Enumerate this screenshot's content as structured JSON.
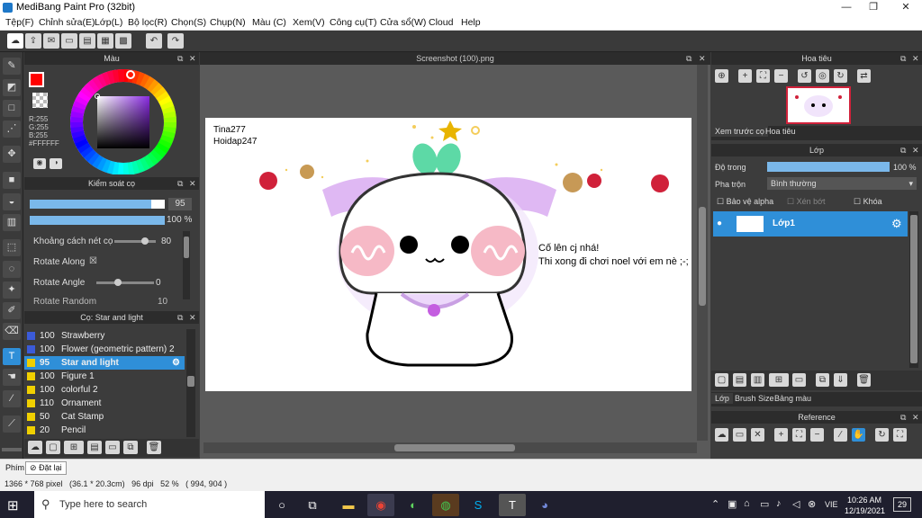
{
  "window": {
    "title": "MediBang Paint Pro (32bit)",
    "minimize_glyph": "—",
    "maximize_glyph": "❐",
    "close_glyph": "✕"
  },
  "menu": [
    "Tệp(F)",
    "Chỉnh sửa(E)",
    "Lớp(L)",
    "Bộ lọc(R)",
    "Chọn(S)",
    "Chụp(N)",
    "Màu (C)",
    "Xem(V)",
    "Công cụ(T)",
    "Cửa sổ(W)",
    "Cloud",
    "Help"
  ],
  "color_panel": {
    "title": "Màu",
    "r_label": "R:255",
    "g_label": "G:255",
    "b_label": "B:255",
    "hex": "#FFFFFF",
    "primary_color": "#ff0000",
    "secondary_color": "#ffffff"
  },
  "brush_control": {
    "title": "Kiểm soát cọ",
    "size_value": "95",
    "size_fraction": 0.9,
    "opacity_value": "100 %",
    "opacity_fraction": 1.0,
    "spacing_label": "Khoảng cách nét cọ",
    "spacing_value": "80",
    "rotate_along_label": "Rotate Along",
    "rotate_along_checked": "☒",
    "rotate_angle_label": "Rotate Angle",
    "rotate_angle_value": "0",
    "cut_label": "Rotate Random",
    "cut_value": "10"
  },
  "brush_list": {
    "title": "Cọ: Star and light",
    "items": [
      {
        "size": "100",
        "name": "Strawberry",
        "color": "#3b5bd9"
      },
      {
        "size": "100",
        "name": "Flower (geometric pattern) 2",
        "color": "#3b5bd9"
      },
      {
        "size": "95",
        "name": "Star and light",
        "color": "#f0d000",
        "selected": true
      },
      {
        "size": "100",
        "name": "Figure 1",
        "color": "#f0d000"
      },
      {
        "size": "100",
        "name": "colorful 2",
        "color": "#f0d000"
      },
      {
        "size": "110",
        "name": "Ornament",
        "color": "#f0d000"
      },
      {
        "size": "50",
        "name": "Cat Stamp",
        "color": "#f0d000"
      },
      {
        "size": "20",
        "name": "Pencil",
        "color": "#f0d000"
      }
    ]
  },
  "canvas": {
    "tab_title": "Screenshot (100).png",
    "text_top_left_1": "Tina277",
    "text_top_left_2": "Hoidap247",
    "speech_1": "Cố lên cj nhá!",
    "speech_2": "Thi xong đi chơi noel với em nè ;-;"
  },
  "navigator": {
    "title": "Hoa tiêu",
    "tab_preview": "Xem trước cọ",
    "tab_nav": "Hoa tiêu"
  },
  "layer_panel": {
    "title": "Lớp",
    "opacity_label": "Độ trong",
    "opacity_value": "100 %",
    "opacity_fraction": 1.0,
    "blend_label": "Pha trộn",
    "blend_value": "Bình thường",
    "protect_alpha": "Bảo vệ alpha",
    "clipping": "Xén bớt",
    "lock": "Khóa",
    "layer_name": "Lớp1",
    "tabs": [
      "Lớp",
      "Brush Size",
      "Bảng màu"
    ]
  },
  "reference": {
    "title": "Reference"
  },
  "status": {
    "phim": "Phím",
    "reset": "Đặt lại",
    "info": "1366 * 768 pixel   (36.1 * 20.3cm)   96 dpi   52 %   ( 994, 904 )"
  },
  "taskbar": {
    "search_placeholder": "Type here to search",
    "lang": "VIE",
    "time": "10:26 AM",
    "date": "12/19/2021",
    "notif_count": "29"
  }
}
